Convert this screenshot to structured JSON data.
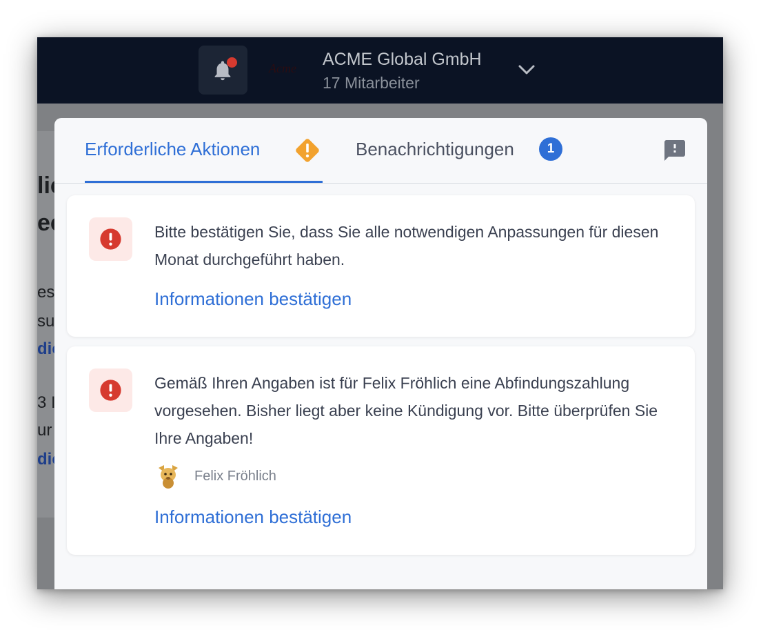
{
  "header": {
    "logo_text": "Acme",
    "company_name": "ACME Global GmbH",
    "employee_count": "17 Mitarbeiter",
    "icons": [
      "bell-icon",
      "chevron-down-icon"
    ],
    "notification_dot_color": "#d63a2f"
  },
  "background_page": {
    "fragments": [
      "lic",
      "ec",
      "es",
      "su",
      "dic",
      "3 I",
      "ur",
      "dic"
    ]
  },
  "tabs": {
    "active_label": "Erforderliche Aktionen",
    "inactive_label": "Benachrichtigungen",
    "inactive_badge": "1",
    "icons": [
      "warning-diamond-icon",
      "feedback-icon"
    ],
    "accent_color": "#2f6fd6",
    "warning_color": "#f2a22e"
  },
  "cards": [
    {
      "message": "Bitte bestätigen Sie, dass Sie alle notwendigen Anpassungen für diesen Monat durchgeführt haben.",
      "action_label": "Informationen bestätigen",
      "icon": "alert-circle-icon"
    },
    {
      "message": "Gemäß Ihren Angaben ist für Felix Fröhlich eine Abfindungszahlung vorgesehen. Bisher liegt aber keine Kündigung vor. Bitte überprüfen Sie Ihre Angaben!",
      "person_name": "Felix Fröhlich",
      "action_label": "Informationen bestätigen",
      "icon": "alert-circle-icon"
    }
  ],
  "alert_color": "#d63a2f"
}
